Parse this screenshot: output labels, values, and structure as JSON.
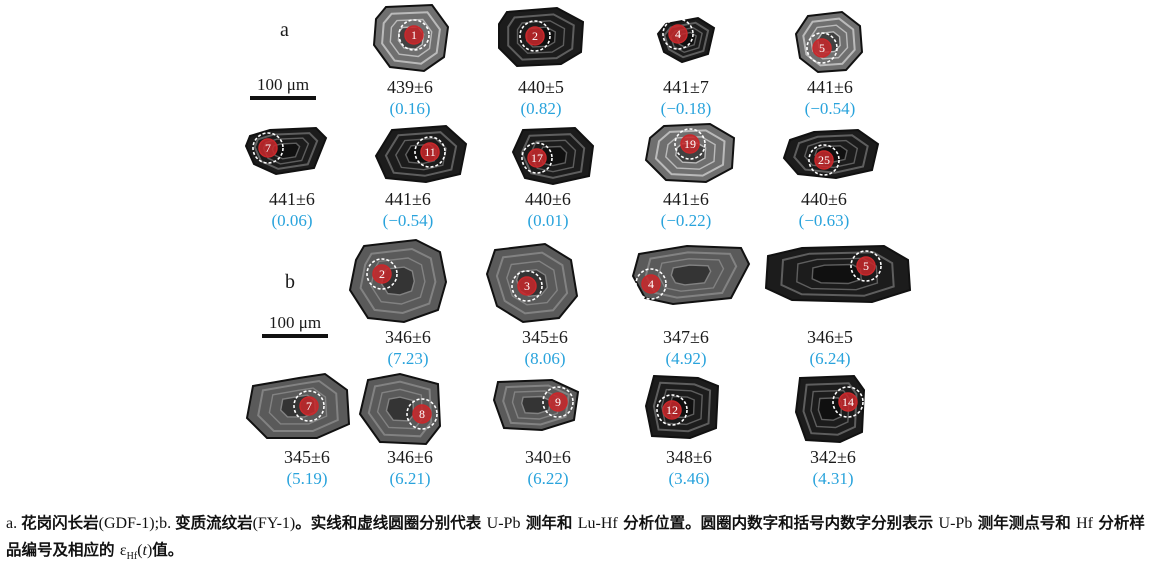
{
  "panels": [
    {
      "label": "a",
      "scale_label": "100 μm",
      "grains": [
        {
          "spot": "1",
          "age": "439±6",
          "ehf": "(0.16)"
        },
        {
          "spot": "2",
          "age": "440±5",
          "ehf": "(0.82)"
        },
        {
          "spot": "4",
          "age": "441±7",
          "ehf": "(−0.18)"
        },
        {
          "spot": "5",
          "age": "441±6",
          "ehf": "(−0.54)"
        },
        {
          "spot": "7",
          "age": "441±6",
          "ehf": "(0.06)"
        },
        {
          "spot": "11",
          "age": "441±6",
          "ehf": "(−0.54)"
        },
        {
          "spot": "17",
          "age": "440±6",
          "ehf": "(0.01)"
        },
        {
          "spot": "19",
          "age": "441±6",
          "ehf": "(−0.22)"
        },
        {
          "spot": "25",
          "age": "440±6",
          "ehf": "(−0.63)"
        }
      ]
    },
    {
      "label": "b",
      "scale_label": "100 μm",
      "grains": [
        {
          "spot": "2",
          "age": "346±6",
          "ehf": "(7.23)"
        },
        {
          "spot": "3",
          "age": "345±6",
          "ehf": "(8.06)"
        },
        {
          "spot": "4",
          "age": "347±6",
          "ehf": "(4.92)"
        },
        {
          "spot": "5",
          "age": "346±5",
          "ehf": "(6.24)"
        },
        {
          "spot": "7",
          "age": "345±6",
          "ehf": "(5.19)"
        },
        {
          "spot": "8",
          "age": "346±6",
          "ehf": "(6.21)"
        },
        {
          "spot": "9",
          "age": "340±6",
          "ehf": "(6.22)"
        },
        {
          "spot": "12",
          "age": "348±6",
          "ehf": "(3.46)"
        },
        {
          "spot": "14",
          "age": "342±6",
          "ehf": "(4.31)"
        }
      ]
    }
  ],
  "caption": {
    "p1": "a. ",
    "p2": "花岗闪长岩",
    "p3": "(GDF-1)",
    "p4": ";b. ",
    "p5": "变质流纹岩",
    "p6": "(FY-1)",
    "p7": "。实线和虚线圆圈分别代表 ",
    "p8": "U-Pb",
    "p9": " 测年和 ",
    "p10": "Lu-Hf",
    "p11": " 分析位置。圆圈内数字和括号内数字分别表示 ",
    "p12": "U-Pb",
    "p13": " 测年测点号和 ",
    "p14": "Hf",
    "p15": " 分析样品编号及相应的 ",
    "p16": "ε",
    "p17": "Hf",
    "p18": "(",
    "p19": "t",
    "p20": ")",
    "p21": "值。"
  },
  "colors": {
    "grain_dark": "#1c1c1c",
    "grain_mid": "#5a5a5a",
    "grain_light": "#c8c8c8",
    "spot_red": "#c8282b",
    "hf_circle": "#ffffff",
    "ehf_text": "#29a3dc"
  }
}
